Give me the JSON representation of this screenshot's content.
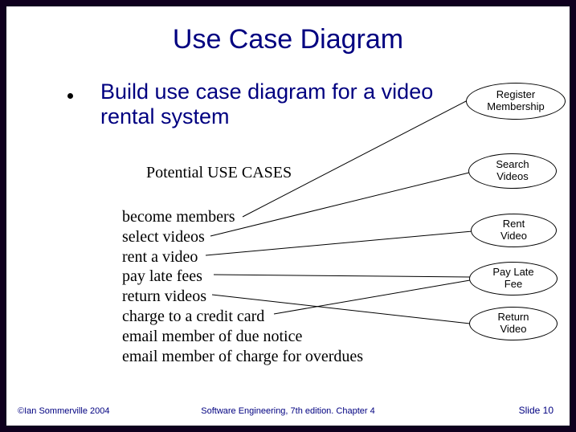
{
  "title": "Use Case Diagram",
  "main_text": "Build use case diagram for a video rental system",
  "subheading": "Potential USE CASES",
  "list_items": [
    "become members",
    "select videos",
    "rent a video",
    "pay late fees",
    "return videos",
    "charge to a credit card",
    "email member of due notice",
    "email member of charge for overdues"
  ],
  "bubbles": [
    {
      "line1": "Register",
      "line2": "Membership"
    },
    {
      "line1": "Search",
      "line2": "Videos"
    },
    {
      "line1": "Rent",
      "line2": "Video"
    },
    {
      "line1": "Pay Late",
      "line2": "Fee"
    },
    {
      "line1": "Return",
      "line2": "Video"
    }
  ],
  "footer": {
    "left": "©Ian Sommerville 2004",
    "center": "Software Engineering, 7th edition. Chapter 4",
    "right": "Slide 10"
  }
}
